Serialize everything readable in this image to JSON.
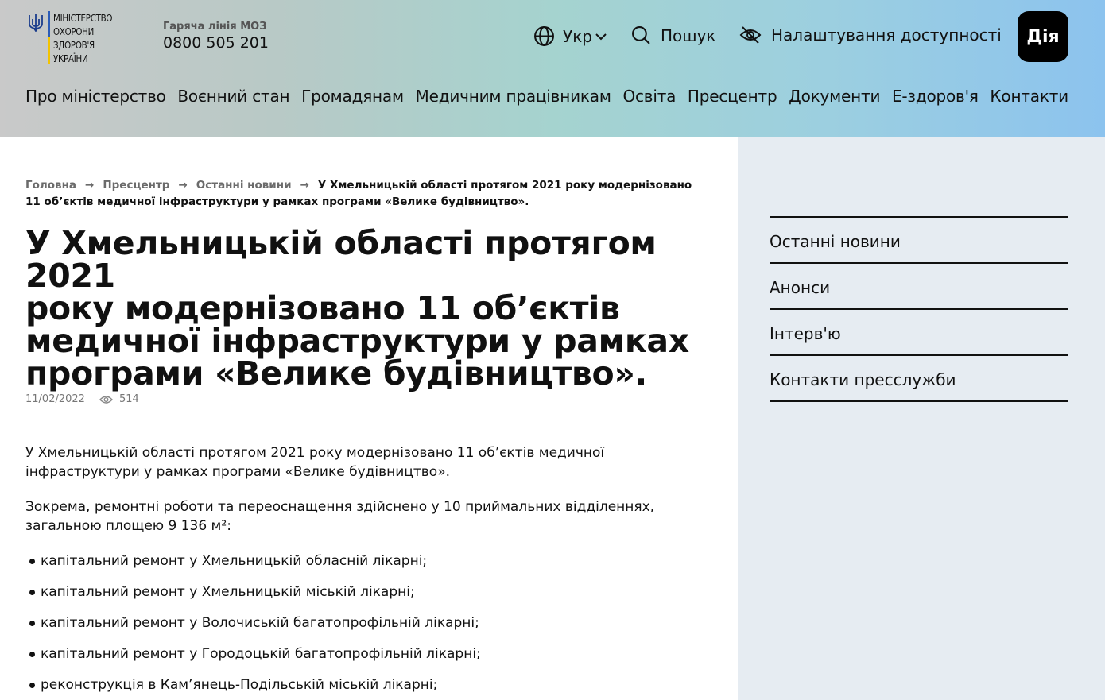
{
  "header": {
    "logo_lines": [
      "МІНІСТЕРСТВО",
      "ОХОРОНИ",
      "ЗДОРОВ'Я",
      "УКРАЇНИ"
    ],
    "hotline_label": "Гаряча лінія МОЗ",
    "hotline_phone": "0800 505 201",
    "language": "Укр",
    "search_label": "Пошук",
    "accessibility_label": "Налаштування доступності",
    "diia_label": "Дія",
    "nav": [
      "Про міністерство",
      "Воєнний стан",
      "Громадянам",
      "Медичним працівникам",
      "Освіта",
      "Пресцентр",
      "Документи",
      "Е-здоров'я",
      "Контакти"
    ]
  },
  "breadcrumb": {
    "items": [
      "Головна",
      "Пресцентр",
      "Останні новини"
    ],
    "current": "У Хмельницькій області протягом 2021 року модернізовано 11 об’єктів медичної інфраструктури у рамках програми «Велике будівництво»."
  },
  "article": {
    "title_lines": [
      "У Хмельницькій області протягом 2021",
      "року модернізовано 11 об’єктів",
      "медичної інфраструктури у рамках",
      "програми «Велике будівництво»."
    ],
    "date": "11/02/2022",
    "views": "514",
    "p1_lines": [
      "У Хмельницькій області протягом 2021 року модернізовано 11 об’єктів медичної",
      "інфраструктури у рамках програми «Велике будівництво»."
    ],
    "p2_lines": [
      "Зокрема, ремонтні роботи та переоснащення здійснено у 10 приймальних відділеннях,",
      "загальною площею 9 136 м²:"
    ],
    "list": [
      "капітальний ремонт у Хмельницькій обласній лікарні;",
      "капітальний ремонт у Хмельницькій міській лікарні;",
      "капітальний ремонт у Волочиській багатопрофільній лікарні;",
      "капітальний ремонт у Городоцькій багатопрофільній лікарні;",
      "реконструкція в Кам’янець-Подільській міській лікарні;"
    ]
  },
  "sidebar": {
    "items": [
      "Останні новини",
      "Анонси",
      "Інтерв'ю",
      "Контакти пресслужби"
    ]
  }
}
